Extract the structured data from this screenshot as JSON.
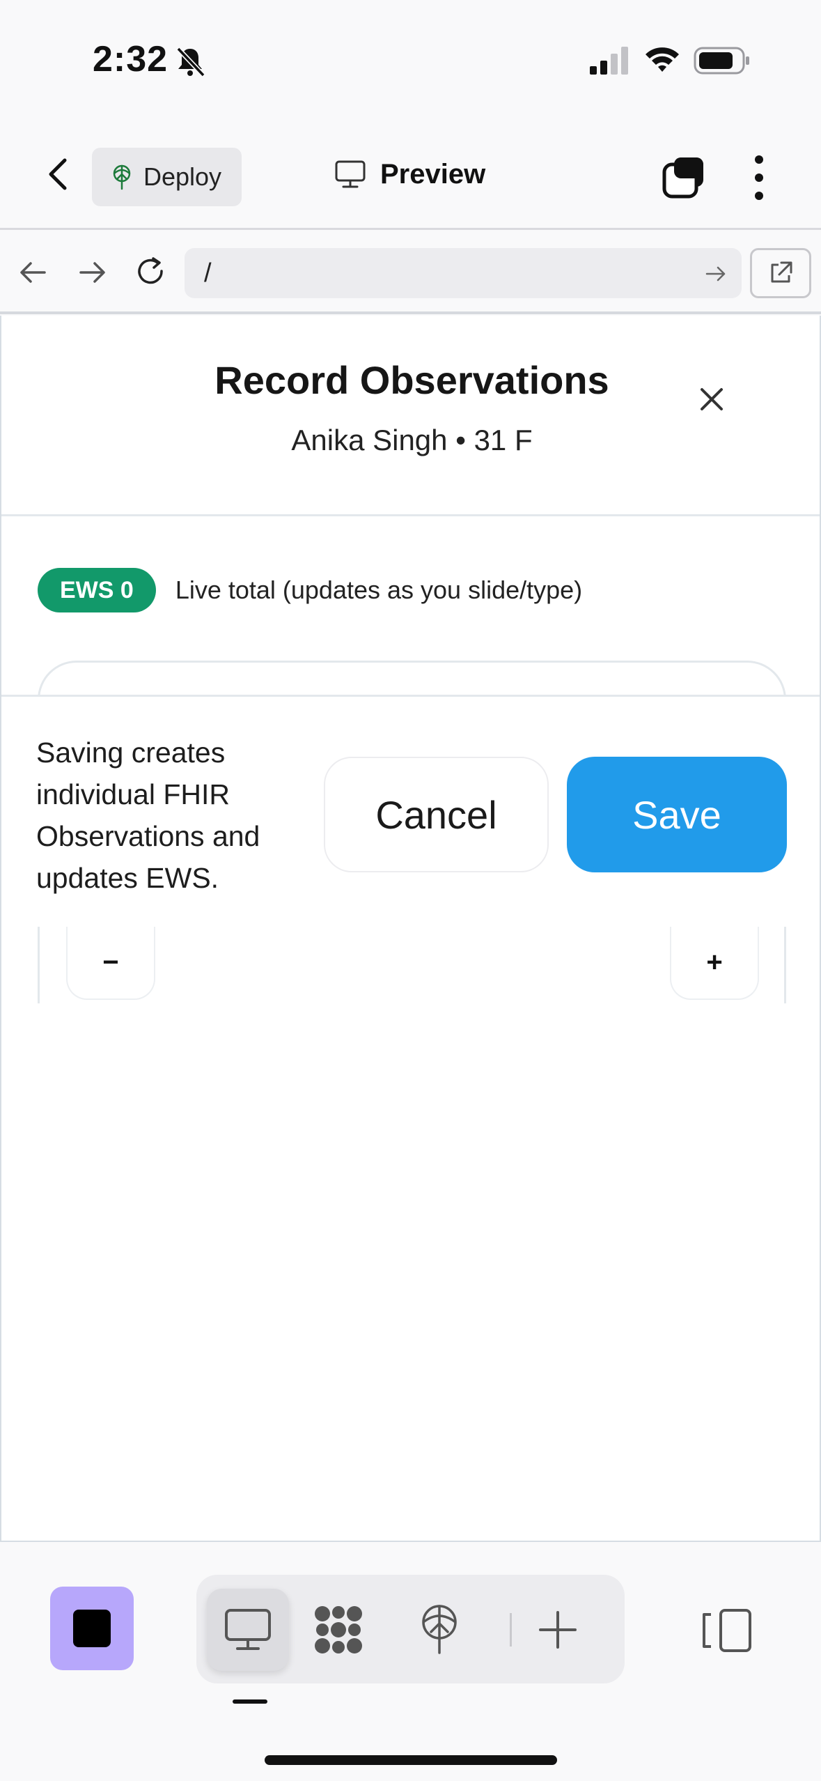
{
  "status_bar": {
    "time": "2:32"
  },
  "app_bar": {
    "deploy_label": "Deploy",
    "title": "Preview"
  },
  "browser": {
    "url": "/"
  },
  "modal": {
    "title": "Record Observations",
    "subtitle": "Anika Singh • 31 F",
    "ews_badge": "EWS 0",
    "ews_note": "Live total (updates as you slide/type)",
    "footer_note": "Saving creates individual FHIR Observations and updates EWS.",
    "cancel_label": "Cancel",
    "save_label": "Save",
    "minus_label": "−",
    "plus_label": "+"
  },
  "colors": {
    "ews_green": "#12996a",
    "save_blue": "#219bea",
    "stop_purple": "#b7a7fb"
  },
  "icons": [
    "bell-slash-icon",
    "signal-icon",
    "wifi-icon",
    "battery-icon",
    "back-chevron-icon",
    "deploy-icon",
    "monitor-icon",
    "tabs-icon",
    "more-vertical-icon",
    "arrow-left-icon",
    "arrow-right-icon",
    "reload-icon",
    "go-arrow-icon",
    "external-link-icon",
    "close-icon",
    "stop-icon",
    "preview-tool-icon",
    "blocks-icon",
    "deploy-tool-icon",
    "plus-icon",
    "side-panel-icon"
  ]
}
